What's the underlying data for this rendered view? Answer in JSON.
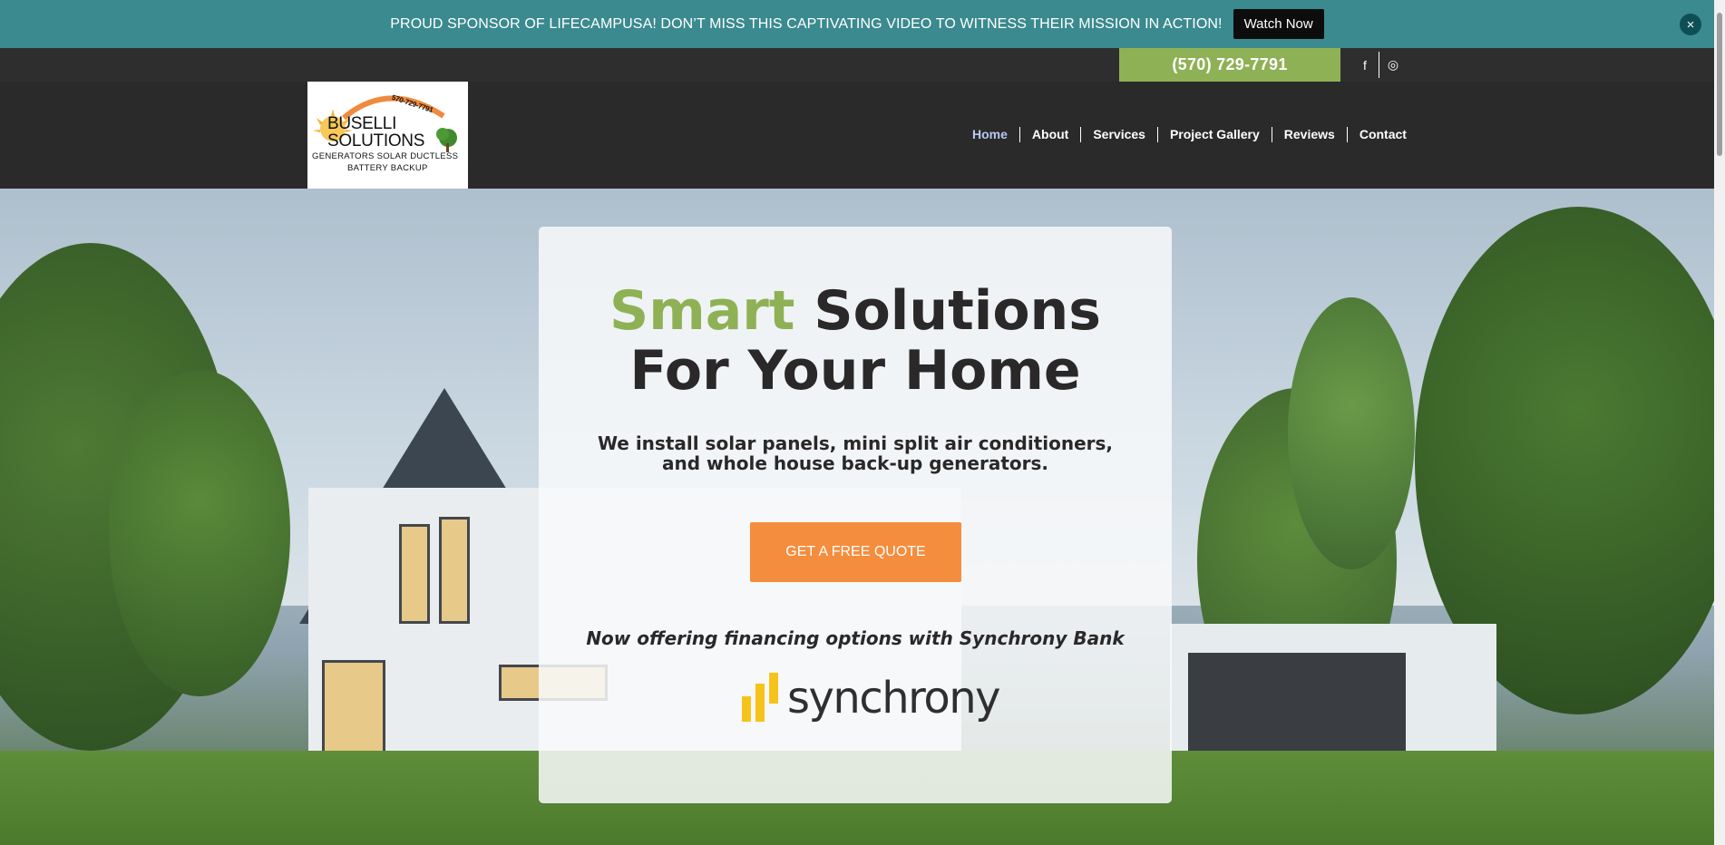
{
  "announcement": {
    "text": "PROUD SPONSOR OF LIFECAMPUSA! DON’T MISS THIS CAPTIVATING VIDEO TO WITNESS THEIR MISSION IN ACTION!",
    "button_label": "Watch Now",
    "close_icon": "×"
  },
  "topbar": {
    "phone": "(570) 729-7791",
    "social": [
      {
        "name": "facebook-icon",
        "glyph": "f"
      },
      {
        "name": "instagram-icon",
        "glyph": "◎"
      }
    ]
  },
  "logo": {
    "phone": "570-729-7791",
    "line1": "BUSELLI",
    "line2": "SOLUTIONS",
    "line3": "GENERATORS  SOLAR  DUCTLESS",
    "line4": "BATTERY BACKUP"
  },
  "nav": {
    "items": [
      "Home",
      "About",
      "Services",
      "Project Gallery",
      "Reviews",
      "Contact"
    ],
    "active": "Home"
  },
  "hero": {
    "title_accent": "Smart",
    "title_rest": "Solutions",
    "title_line2": "For Your Home",
    "subtitle": "We install solar panels, mini split air conditioners, and whole house back-up generators.",
    "cta_label": "GET A FREE QUOTE",
    "financing_text": "Now offering financing options with Synchrony Bank",
    "partner_logo_text": "synchrony"
  },
  "colors": {
    "announcement_bg": "#3a8a8f",
    "accent_green": "#8fb155",
    "cta_orange": "#f58d3e",
    "header_bg": "#2b2a2b",
    "synchrony_yellow": "#f6c31a"
  }
}
